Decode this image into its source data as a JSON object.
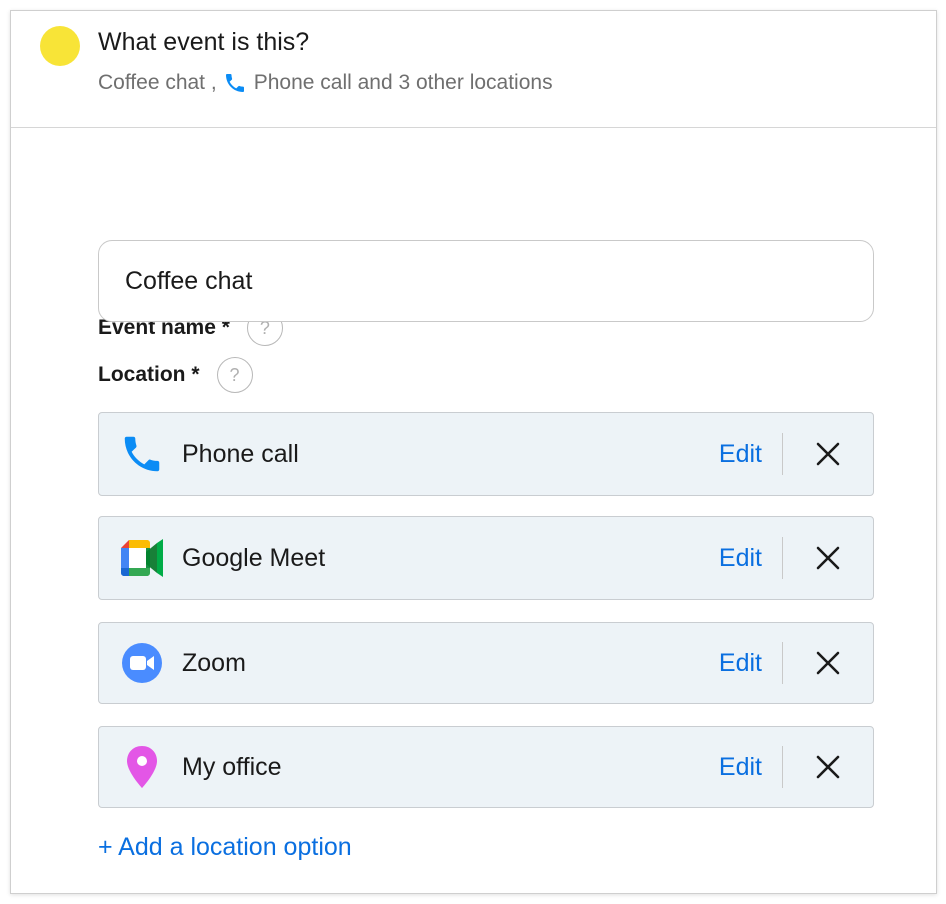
{
  "header": {
    "title": "What event is this?",
    "summary_name": "Coffee chat ,",
    "summary_location": "Phone call and 3 other locations",
    "dot_color": "#f8e437"
  },
  "event_name": {
    "label": "Event name *",
    "help_icon": "?",
    "value": "Coffee chat"
  },
  "location": {
    "label": "Location *",
    "help_icon": "?",
    "items": [
      {
        "label": "Phone call",
        "icon": "phone-icon",
        "edit": "Edit"
      },
      {
        "label": "Google Meet",
        "icon": "google-meet-icon",
        "edit": "Edit"
      },
      {
        "label": "Zoom",
        "icon": "zoom-icon",
        "edit": "Edit"
      },
      {
        "label": "My office",
        "icon": "map-pin-icon",
        "edit": "Edit"
      }
    ],
    "add_label": "+ Add a location option"
  },
  "colors": {
    "accent": "#0a6fe0",
    "phone": "#0b8cf5",
    "zoom": "#4a8cff",
    "pin": "#e356e6",
    "location_bg": "#edf3f7"
  }
}
